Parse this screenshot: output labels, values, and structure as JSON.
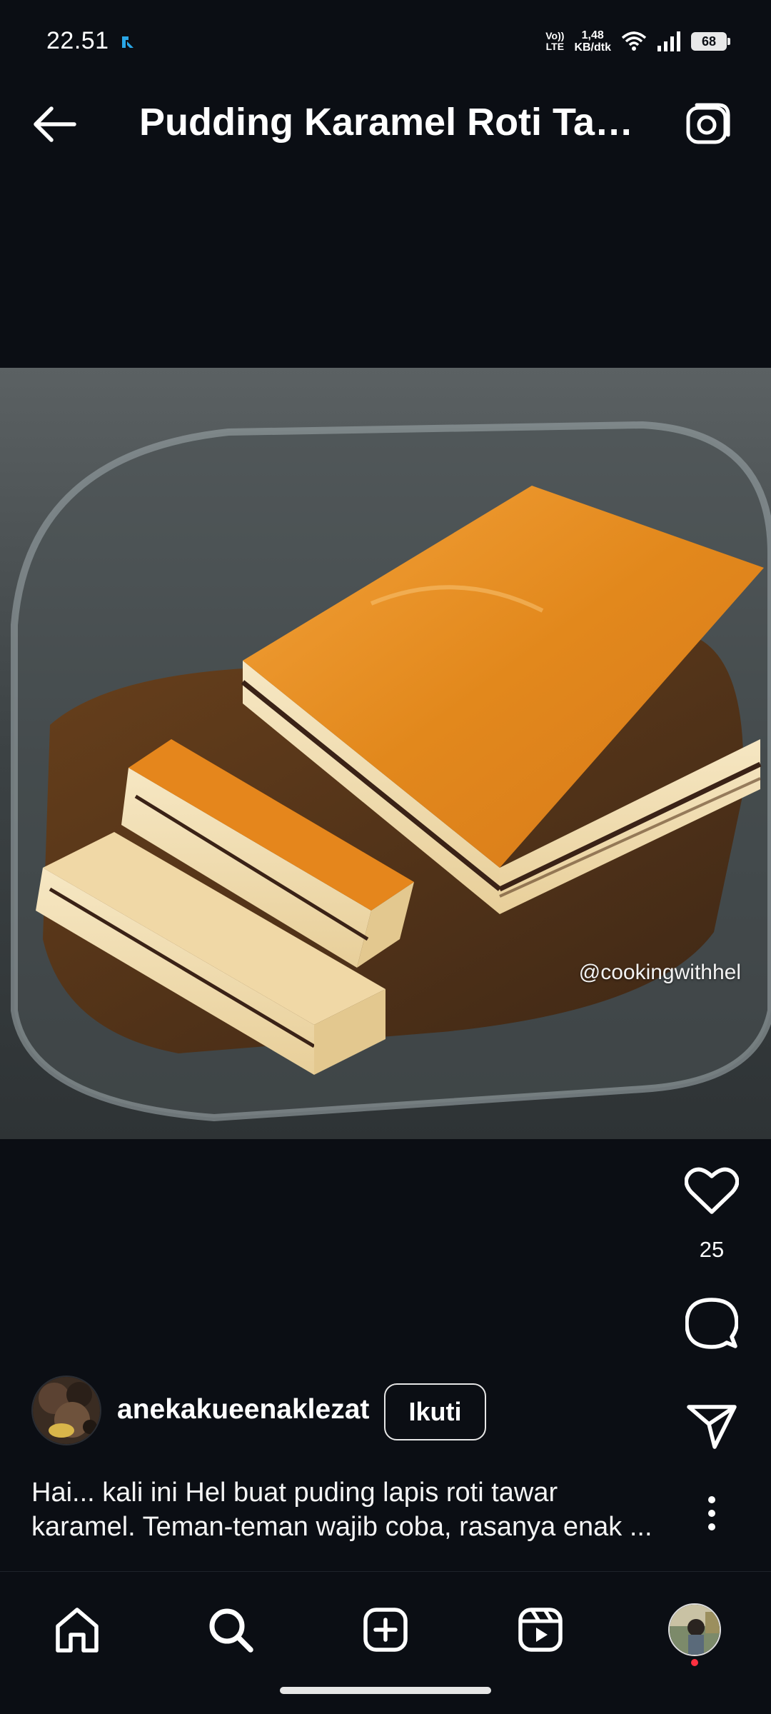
{
  "status_bar": {
    "time": "22.51",
    "volte_top": "Vo))",
    "volte_bottom": "LTE",
    "speed_value": "1,48",
    "speed_unit": "KB/dtk",
    "battery": "68"
  },
  "header": {
    "title": "Pudding Karamel Roti Taw..."
  },
  "post": {
    "watermark": "@cookingwithhel",
    "likes": "25",
    "author": "anekakueenaklezat",
    "follow_label": "Ikuti",
    "caption_line1": "Hai... kali ini Hel buat puding lapis roti tawar",
    "caption_line2": "karamel. Teman-teman wajib coba, rasanya enak ..."
  },
  "icons": {
    "back": "arrow-left-icon",
    "camera": "camera-icon",
    "like": "heart-icon",
    "comment": "comment-icon",
    "share": "paper-plane-icon",
    "more": "more-vertical-icon",
    "home": "home-icon",
    "search": "search-icon",
    "create": "plus-square-icon",
    "reels": "reels-icon"
  },
  "colors": {
    "background": "#0b0e14",
    "notification_dot": "#ff3040",
    "caramel": "#e88a1a"
  }
}
